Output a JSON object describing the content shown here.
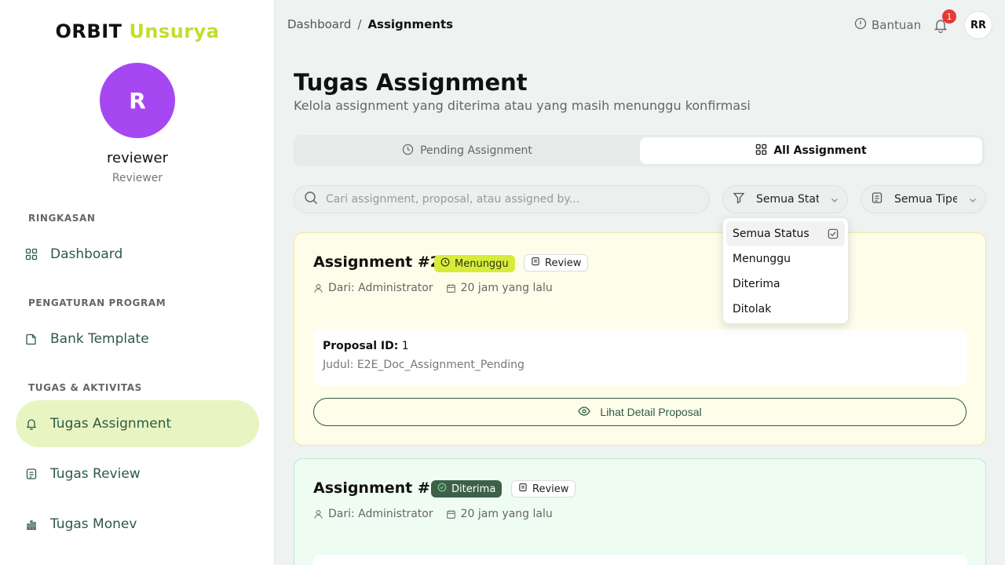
{
  "brand": {
    "part1": "ORBIT",
    "part2": "Unsurya"
  },
  "user": {
    "initial": "R",
    "name": "reviewer",
    "role": "Reviewer"
  },
  "sidebar": {
    "sections": [
      {
        "title": "RINGKASAN"
      },
      {
        "title": "PENGATURAN PROGRAM"
      },
      {
        "title": "TUGAS & AKTIVITAS"
      }
    ],
    "items": [
      {
        "label": "Dashboard",
        "icon": "grid-icon"
      },
      {
        "label": "Bank Template",
        "icon": "file-icon"
      },
      {
        "label": "Tugas Assignment",
        "icon": "bell-icon",
        "active": true
      },
      {
        "label": "Tugas Review",
        "icon": "document-icon"
      },
      {
        "label": "Tugas Monev",
        "icon": "bar-chart-icon"
      }
    ]
  },
  "topbar": {
    "breadcrumb": {
      "root": "Dashboard",
      "sep": "/",
      "current": "Assignments"
    },
    "help_label": "Bantuan",
    "notif_count": "1",
    "avatar_initials": "RR"
  },
  "page": {
    "title": "Tugas Assignment",
    "subtitle": "Kelola assignment yang diterima atau yang masih menunggu konfirmasi"
  },
  "tabs": [
    {
      "label": "Pending Assignment"
    },
    {
      "label": "All Assignment",
      "active": true
    }
  ],
  "filters": {
    "search_placeholder": "Cari assignment, proposal, atau assigned by...",
    "status_value": "Semua Status",
    "type_value": "Semua Tipe"
  },
  "status_dropdown": {
    "options": [
      "Semua Status",
      "Menunggu",
      "Diterima",
      "Ditolak"
    ],
    "selected": "Semua Status"
  },
  "cards": [
    {
      "title": "Assignment #2",
      "status": "Menunggu",
      "type": "Review",
      "from": "Dari: Administrator",
      "time": "20 jam yang lalu",
      "proposal_label": "Proposal ID:",
      "proposal_id": "1",
      "judul": "Judul: E2E_Doc_Assignment_Pending",
      "detail_button": "Lihat Detail Proposal"
    },
    {
      "title": "Assignment #1",
      "status": "Diterima",
      "type": "Review",
      "from": "Dari: Administrator",
      "time": "20 jam yang lalu"
    }
  ],
  "colors": {
    "accent_lime": "#c6dc2c",
    "avatar_purple": "#a548f2",
    "nav_green": "#2e5a44",
    "active_nav_bg": "#e8f5c2",
    "pending_card_bg": "#fefde9",
    "accepted_card_bg": "#eefcf2",
    "badge_red": "#e53935"
  }
}
